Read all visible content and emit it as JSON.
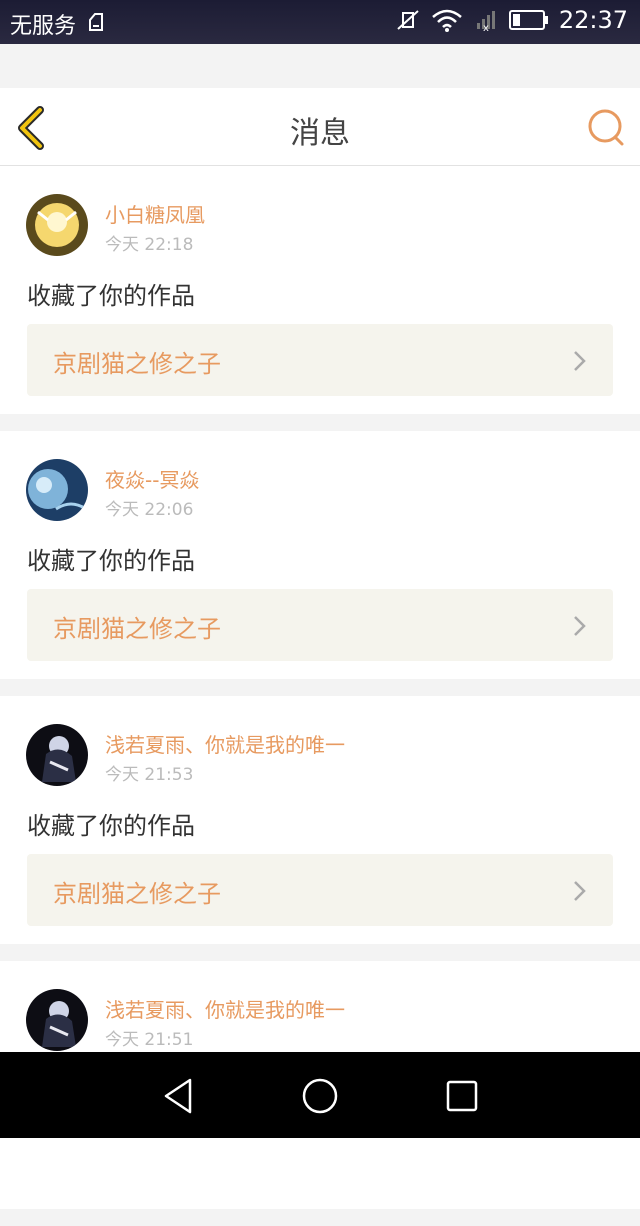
{
  "status_bar": {
    "carrier": "无服务",
    "time": "22:37"
  },
  "header": {
    "title": "消息"
  },
  "messages": [
    {
      "user": "小白糖凤凰",
      "time": "今天 22:18",
      "action": "收藏了你的作品",
      "work": "京剧猫之修之子"
    },
    {
      "user": "夜焱--冥焱",
      "time": "今天 22:06",
      "action": "收藏了你的作品",
      "work": "京剧猫之修之子"
    },
    {
      "user": "浅若夏雨、你就是我的唯一",
      "time": "今天 21:53",
      "action": "收藏了你的作品",
      "work": "京剧猫之修之子"
    },
    {
      "user": "浅若夏雨、你就是我的唯一",
      "time": "今天 21:51"
    }
  ],
  "colors": {
    "accent": "#e79a60",
    "back_arrow": "#f1c40f"
  }
}
